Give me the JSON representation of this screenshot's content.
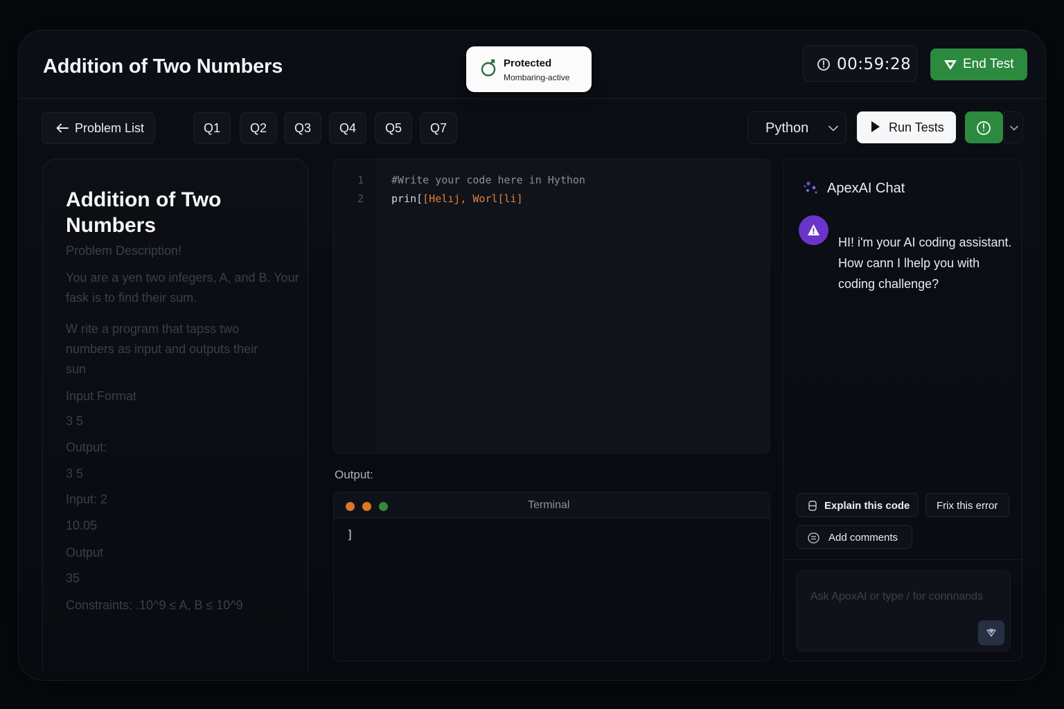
{
  "header": {
    "title": "Addition of Two Numbers",
    "protected_title": "Protected",
    "protected_sub": "Mombaring-active",
    "timer": "00:59:28",
    "end_test": "End Test"
  },
  "toolbar": {
    "problem_list": "Problem List",
    "questions": [
      "Q1",
      "Q2",
      "Q3",
      "Q4",
      "Q5",
      "Q7"
    ],
    "language": "Python",
    "run_tests": "Run Tests"
  },
  "problem": {
    "title": "Addition of Two Numbers",
    "lines": [
      "Problem Description!",
      "You are a yen two infegers,  A, and B. Your fask is to find their sum.",
      "W rite a program that tapss two numbers as input and outputs their sun",
      "Input Format",
      "3 5",
      "Output:",
      "3 5",
      "Input:  2",
      "10.05",
      "Output",
      "35",
      "Constraints:  .10^9 ≤ A, B ≤ 10^9"
    ]
  },
  "editor": {
    "line_numbers": [
      "1",
      "2"
    ],
    "line1": "#Write your code here in Hython",
    "line2_fn": "prin[",
    "line2_str": "[Helıj, Worl[li]"
  },
  "output": {
    "label": "Output:",
    "terminal_title": "Terminal",
    "terminal_text": "]"
  },
  "chat": {
    "title": "ApexAI Chat",
    "message": "HI! i'm your AI coding assistant. How cann I lhelp you with coding challenge?",
    "chips": [
      "Explain this code",
      "Frix this error",
      "Add comments"
    ],
    "input_placeholder": "Ask ApoxAl or type / for connnands"
  },
  "colors": {
    "accent_green": "#2b8a3e",
    "avatar_purple": "#6a34c9",
    "string_orange": "#e3803c"
  }
}
